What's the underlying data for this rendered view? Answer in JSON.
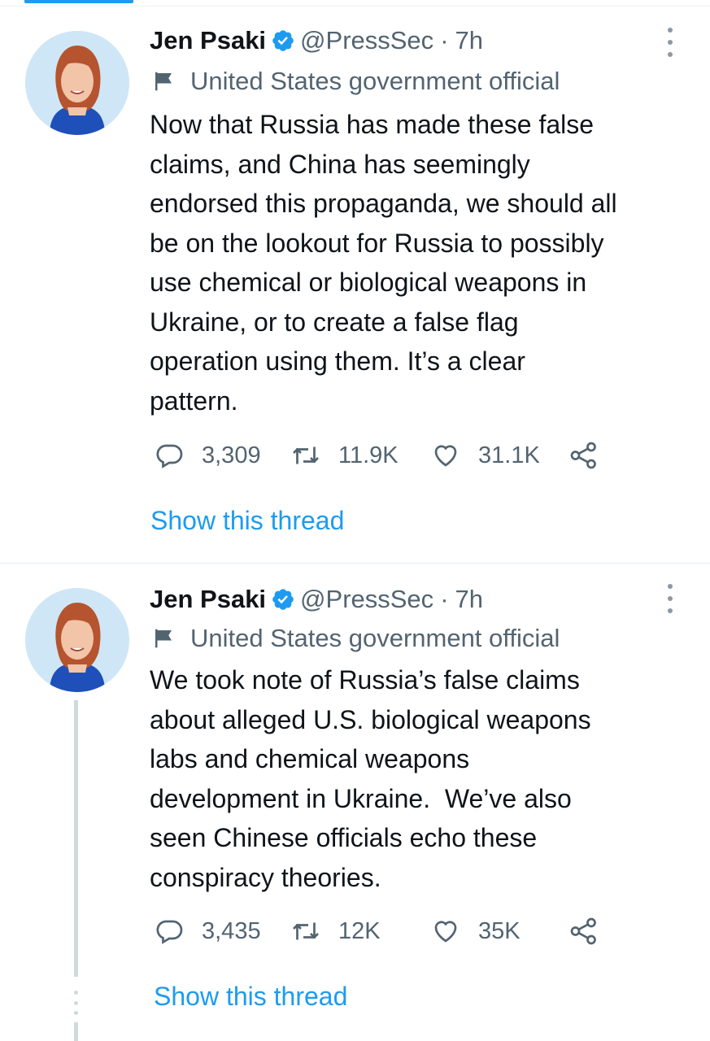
{
  "tweets": [
    {
      "name": "Jen Psaki",
      "handle": "@PressSec",
      "separator": "·",
      "time": "7h",
      "label": "United States government official",
      "text": "Now that Russia has made these false\nclaims, and China has seemingly\nendorsed this propaganda, we should all\nbe on the lookout for Russia to possibly\nuse chemical or biological weapons in\nUkraine, or to create a false flag\noperation using them. It’s a clear\npattern.",
      "replies": "3,309",
      "retweets": "11.9K",
      "likes": "31.1K",
      "show_thread": "Show this thread"
    },
    {
      "name": "Jen Psaki",
      "handle": "@PressSec",
      "separator": "·",
      "time": "7h",
      "label": "United States government official",
      "text": "We took note of Russia’s false claims\nabout alleged U.S. biological weapons\nlabs and chemical weapons\ndevelopment in Ukraine.  We’ve also\nseen Chinese officials echo these\nconspiracy theories.",
      "replies": "3,435",
      "retweets": "12K",
      "likes": "35K",
      "show_thread": "Show this thread"
    }
  ],
  "icons": {
    "verified": "verified-badge-icon",
    "label": "flag-icon",
    "more": "more-options-icon",
    "reply": "reply-icon",
    "retweet": "retweet-icon",
    "like": "heart-icon",
    "share": "share-icon"
  },
  "colors": {
    "accent": "#1d9bf0",
    "secondary_text": "#536471",
    "text": "#0f1419",
    "thread_line": "#cfd9de"
  }
}
